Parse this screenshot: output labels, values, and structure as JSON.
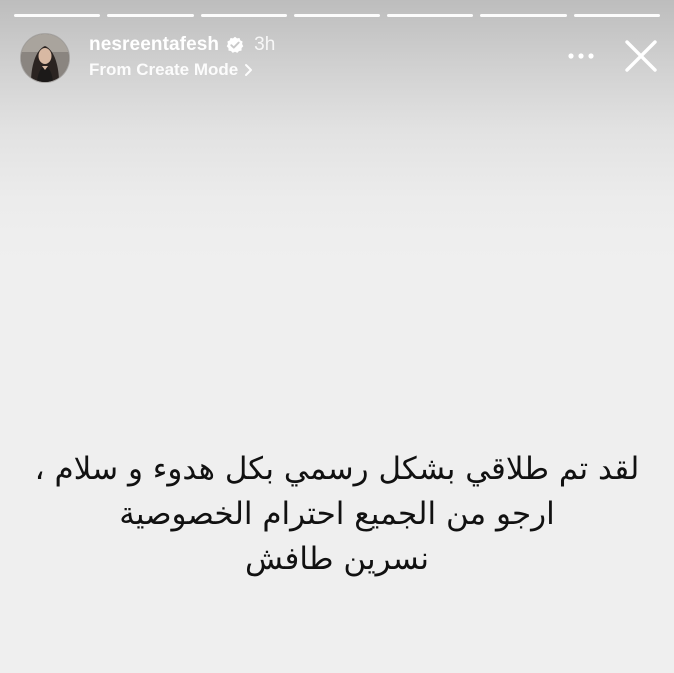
{
  "progress": {
    "segment_count": 7,
    "color": "#ffffff"
  },
  "header": {
    "username": "nesreentafesh",
    "verified": true,
    "time": "3h",
    "subtitle": "From Create Mode",
    "more_icon": "more-horizontal-icon",
    "close_icon": "close-icon"
  },
  "story": {
    "lines": [
      "لقد تم طلاقي بشكل رسمي بكل هدوء و سلام ،",
      "ارجو من الجميع احترام الخصوصية",
      "نسرين طافش"
    ]
  },
  "colors": {
    "background": "#efefef",
    "text": "#111111",
    "header_text": "#ffffff"
  }
}
